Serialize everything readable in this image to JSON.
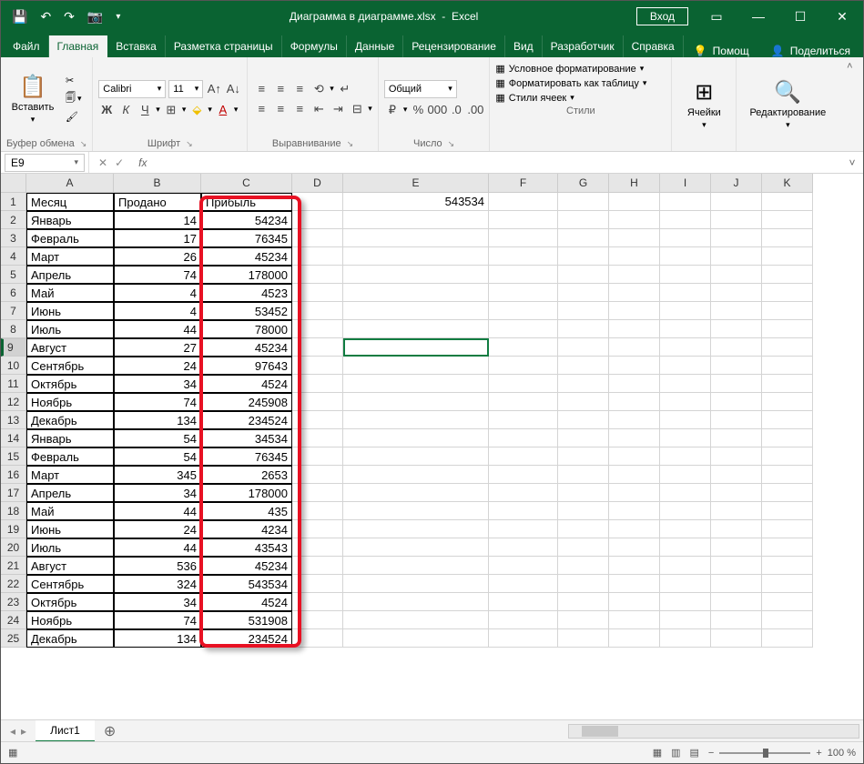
{
  "titlebar": {
    "filename": "Диаграмма в диаграмме.xlsx",
    "app": "Excel",
    "login": "Вход"
  },
  "tabs": {
    "file": "Файл",
    "home": "Главная",
    "insert": "Вставка",
    "layout": "Разметка страницы",
    "formulas": "Формулы",
    "data": "Данные",
    "review": "Рецензирование",
    "view": "Вид",
    "developer": "Разработчик",
    "help": "Справка",
    "tellme": "Помощ",
    "share": "Поделиться"
  },
  "ribbon": {
    "clipboard": {
      "label": "Буфер обмена",
      "paste": "Вставить"
    },
    "font": {
      "label": "Шрифт",
      "name": "Calibri",
      "size": "11"
    },
    "align": {
      "label": "Выравнивание"
    },
    "number": {
      "label": "Число",
      "format": "Общий"
    },
    "styles": {
      "label": "Стили",
      "cond": "Условное форматирование",
      "table": "Форматировать как таблицу",
      "cell": "Стили ячеек"
    },
    "cells": {
      "label": "Ячейки"
    },
    "editing": {
      "label": "Редактирование"
    }
  },
  "fbar": {
    "name": "E9",
    "fx": "fx",
    "value": ""
  },
  "columns": [
    "A",
    "B",
    "C",
    "D",
    "E",
    "F",
    "G",
    "H",
    "I",
    "J",
    "K"
  ],
  "headers": {
    "month": "Месяц",
    "sold": "Продано",
    "profit": "Прибыль"
  },
  "e1_value": "543534",
  "rows": [
    {
      "n": 1
    },
    {
      "n": 2,
      "m": "Январь",
      "s": "14",
      "p": "54234"
    },
    {
      "n": 3,
      "m": "Февраль",
      "s": "17",
      "p": "76345"
    },
    {
      "n": 4,
      "m": "Март",
      "s": "26",
      "p": "45234"
    },
    {
      "n": 5,
      "m": "Апрель",
      "s": "74",
      "p": "178000"
    },
    {
      "n": 6,
      "m": "Май",
      "s": "4",
      "p": "4523"
    },
    {
      "n": 7,
      "m": "Июнь",
      "s": "4",
      "p": "53452"
    },
    {
      "n": 8,
      "m": "Июль",
      "s": "44",
      "p": "78000"
    },
    {
      "n": 9,
      "m": "Август",
      "s": "27",
      "p": "45234"
    },
    {
      "n": 10,
      "m": "Сентябрь",
      "s": "24",
      "p": "97643"
    },
    {
      "n": 11,
      "m": "Октябрь",
      "s": "34",
      "p": "4524"
    },
    {
      "n": 12,
      "m": "Ноябрь",
      "s": "74",
      "p": "245908"
    },
    {
      "n": 13,
      "m": "Декабрь",
      "s": "134",
      "p": "234524"
    },
    {
      "n": 14,
      "m": "Январь",
      "s": "54",
      "p": "34534"
    },
    {
      "n": 15,
      "m": "Февраль",
      "s": "54",
      "p": "76345"
    },
    {
      "n": 16,
      "m": "Март",
      "s": "345",
      "p": "2653"
    },
    {
      "n": 17,
      "m": "Апрель",
      "s": "34",
      "p": "178000"
    },
    {
      "n": 18,
      "m": "Май",
      "s": "44",
      "p": "435"
    },
    {
      "n": 19,
      "m": "Июнь",
      "s": "24",
      "p": "4234"
    },
    {
      "n": 20,
      "m": "Июль",
      "s": "44",
      "p": "43543"
    },
    {
      "n": 21,
      "m": "Август",
      "s": "536",
      "p": "45234"
    },
    {
      "n": 22,
      "m": "Сентябрь",
      "s": "324",
      "p": "543534"
    },
    {
      "n": 23,
      "m": "Октябрь",
      "s": "34",
      "p": "4524"
    },
    {
      "n": 24,
      "m": "Ноябрь",
      "s": "74",
      "p": "531908"
    },
    {
      "n": 25,
      "m": "Декабрь",
      "s": "134",
      "p": "234524"
    }
  ],
  "sheet": {
    "name": "Лист1"
  },
  "status": {
    "zoom": "100 %"
  },
  "selected_row": 9
}
